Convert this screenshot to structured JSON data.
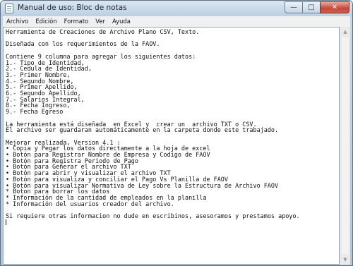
{
  "window": {
    "title": "Manual de uso: Bloc de notas",
    "minimize_glyph": "—",
    "maximize_glyph": "□",
    "close_glyph": "✕"
  },
  "menu": [
    "Archivo",
    "Edición",
    "Formato",
    "Ver",
    "Ayuda"
  ],
  "document": {
    "lines": [
      "Herramienta de Creaciones de Archivo Plano CSV, Texto.",
      "",
      "Diseñada con los requerimientos de la FAOV.",
      "",
      "Contiene 9 columna para agregar los siguientes datos:",
      "1.- Tipo de Identidad,",
      "2.- Cedula de Identidad,",
      "3.- Primer Nombre,",
      "4.- Segundo Nombre,",
      "5.- Primer Apellido,",
      "6.- Segundo Apellido,",
      "7.- Salarios Integral,",
      "8.- Fecha Ingreso,",
      "9.- Fecha Egreso",
      "",
      "La herramienta está diseñada  en Excel y  crear un  archivo TXT o CSV.",
      "El archivo ser guardaran automáticamente en la carpeta donde este trabajado.",
      "",
      "Mejorar realizada, Version 4.1 :",
      "• Copia y Pegar los datos directamente a la hoja de excel",
      "• Botón para Registrar Nombre de Empresa y Codigo de FAOV",
      "• Botón para Registra Periodo de Pago",
      "• Botón para Generar el archivo TXT",
      "• Botón para abrir y visualizar el archivo TXT",
      "• Botón para visualiza y conciliar el Pago Vs Planilla de FAOV",
      "• Botón para visualizar Normativa de Ley sobre la Estructura de Archivo FAOV",
      "* Boton para borrar los datos",
      "* Información de la cantidad de empleados en la planilla",
      "* Información del usuarios creador del archivo.",
      "",
      "Si requiere otras informacion no dude en escribinos, asesoramos y prestamos apoyo."
    ]
  },
  "scrollbar": {
    "up_glyph": "▲",
    "down_glyph": "▼"
  }
}
